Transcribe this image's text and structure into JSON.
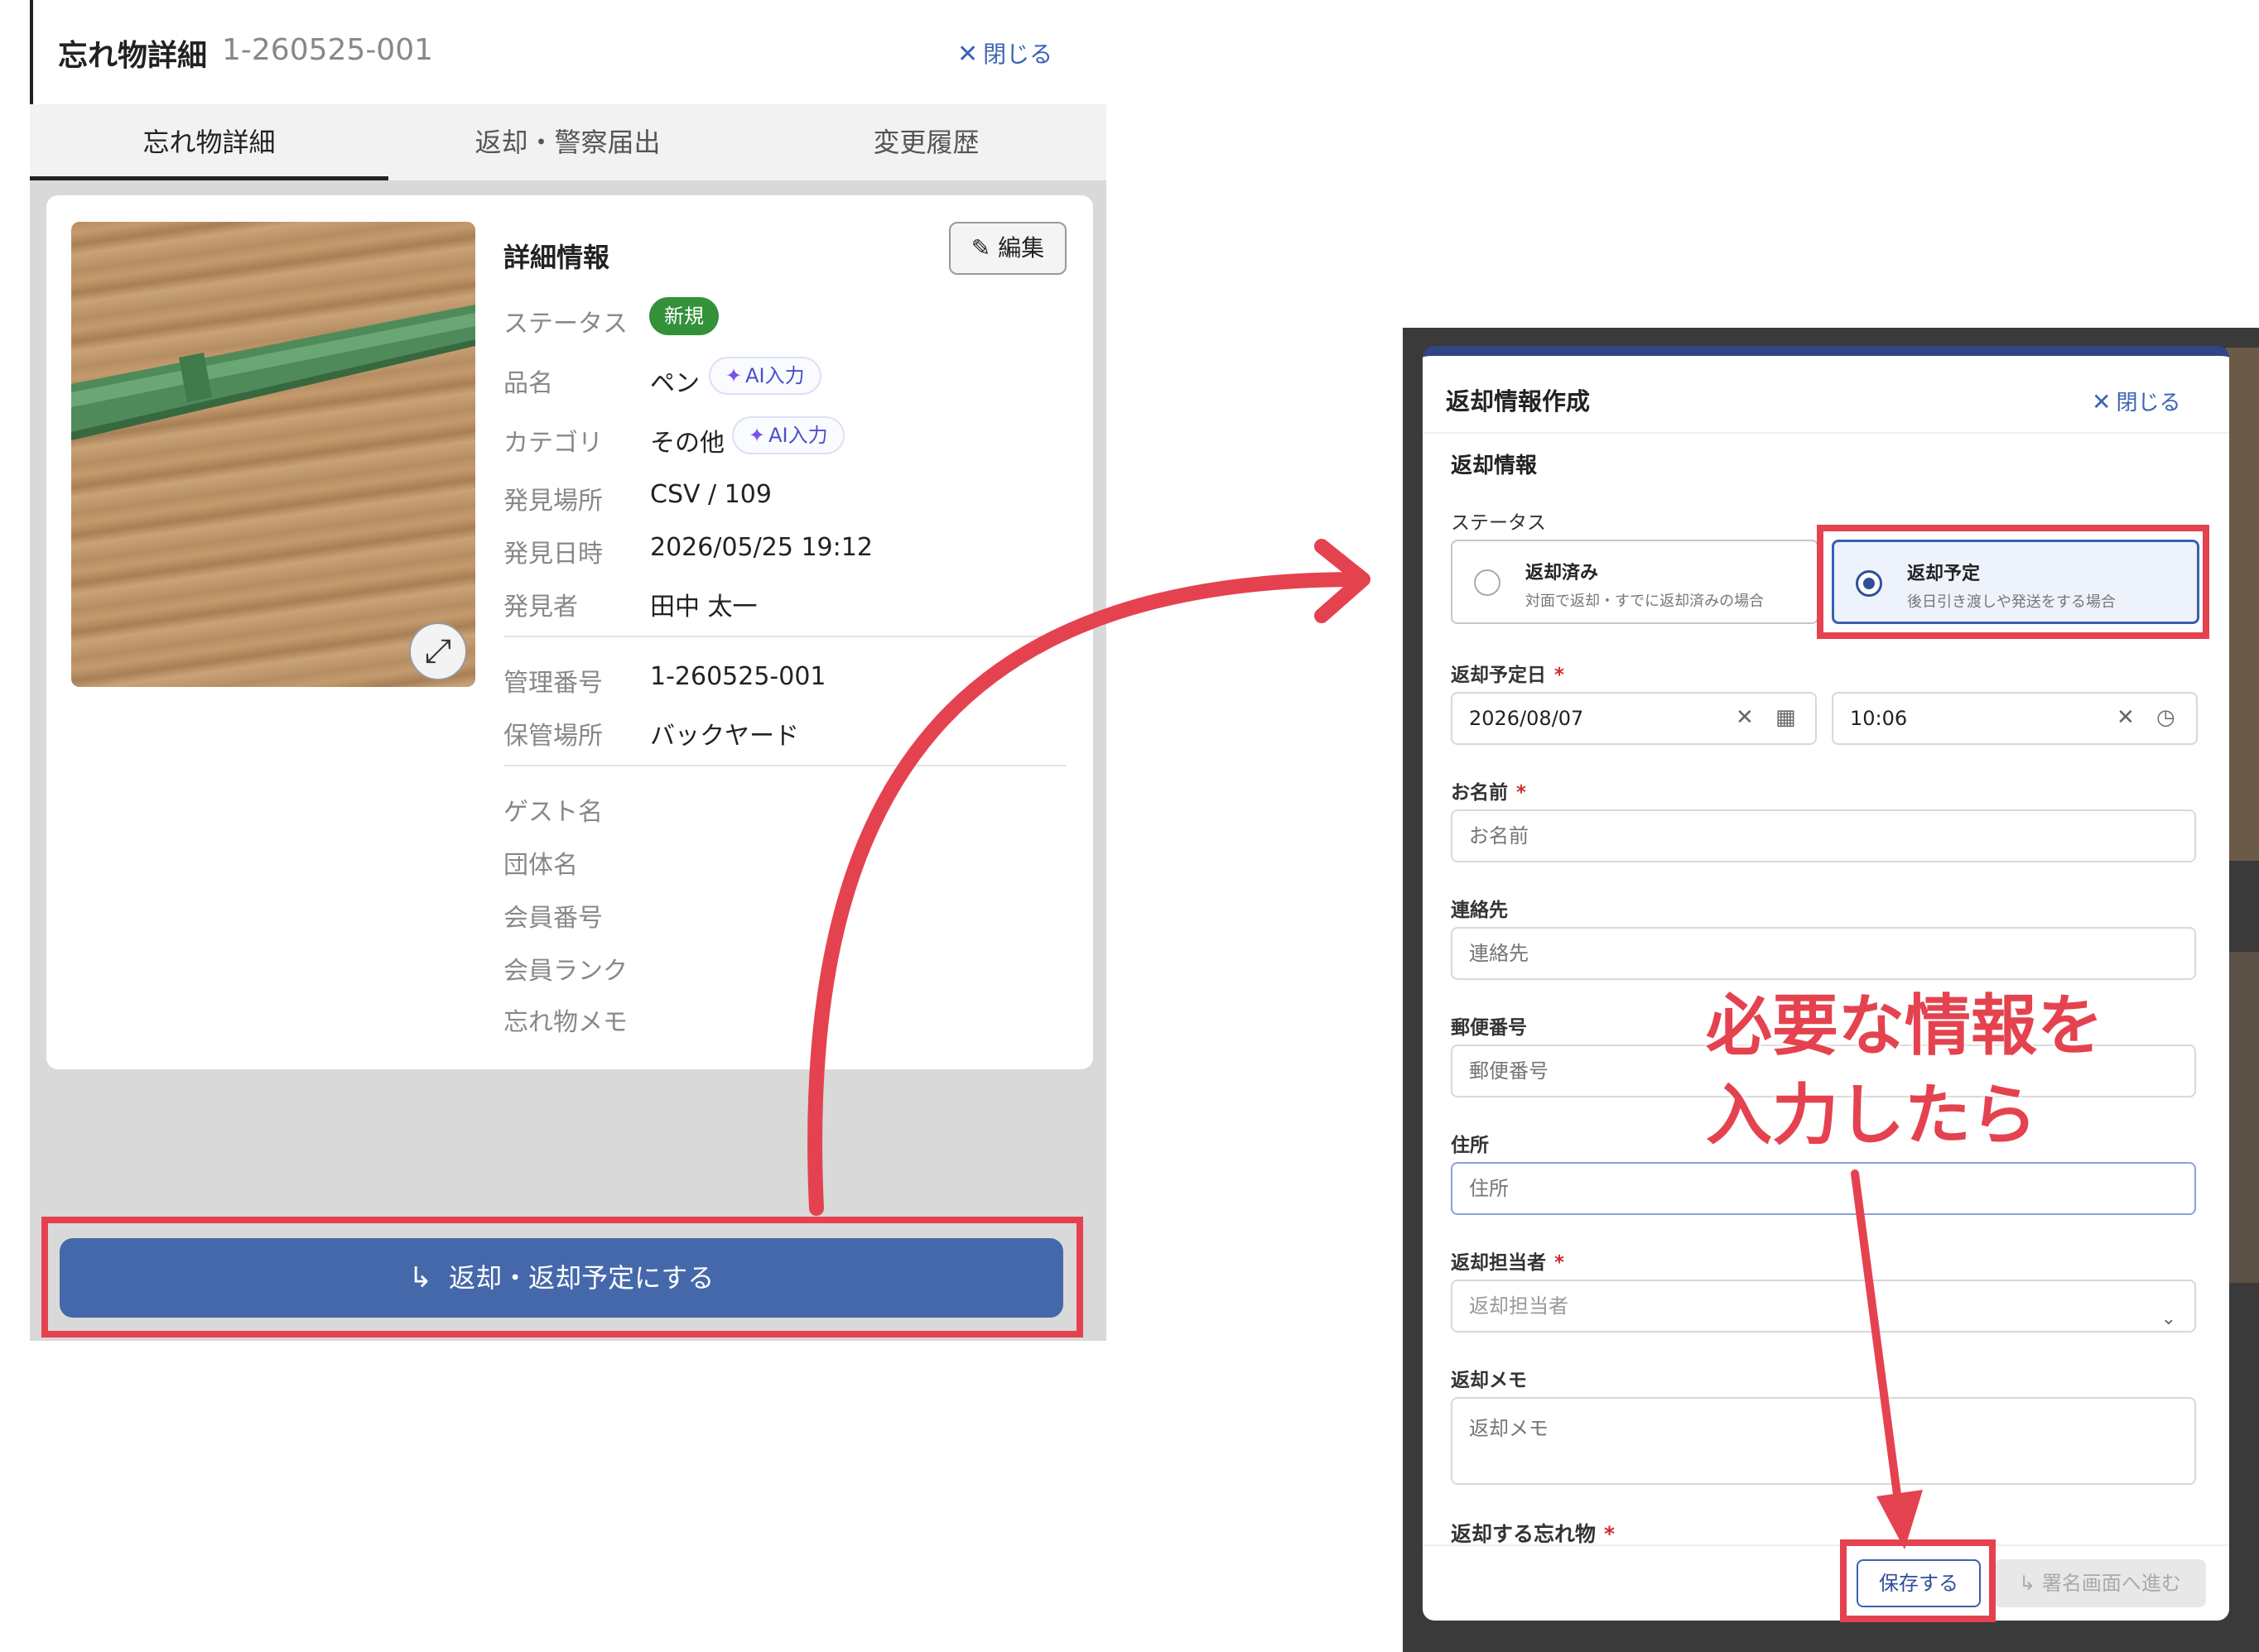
{
  "left": {
    "title": "忘れ物詳細",
    "item_id": "1-260525-001",
    "close_label": "閉じる",
    "tabs": [
      "忘れ物詳細",
      "返却・警察届出",
      "変更履歴"
    ],
    "detail_title": "詳細情報",
    "edit_label": "編集",
    "ai_label": "AI入力",
    "status_label": "ステータス",
    "status_value": "新規",
    "fields": {
      "name": {
        "label": "品名",
        "value": "ペン"
      },
      "category": {
        "label": "カテゴリ",
        "value": "その他"
      },
      "found_place": {
        "label": "発見場所",
        "value": "CSV / 109"
      },
      "found_at": {
        "label": "発見日時",
        "value": "2026/05/25 19:12"
      },
      "finder": {
        "label": "発見者",
        "value": "田中 太一"
      },
      "mgmt_no": {
        "label": "管理番号",
        "value": "1-260525-001"
      },
      "storage": {
        "label": "保管場所",
        "value": "バックヤード"
      },
      "guest": {
        "label": "ゲスト名"
      },
      "group": {
        "label": "団体名"
      },
      "member_no": {
        "label": "会員番号"
      },
      "member_rank": {
        "label": "会員ランク"
      },
      "memo": {
        "label": "忘れ物メモ"
      }
    },
    "main_action_label": "返却・返却予定にする"
  },
  "modal": {
    "title": "返却情報作成",
    "close_label": "閉じる",
    "section_title": "返却情報",
    "status_label": "ステータス",
    "options": [
      {
        "title": "返却済み",
        "desc": "対面で返却・すでに返却済みの場合",
        "selected": false
      },
      {
        "title": "返却予定",
        "desc": "後日引き渡しや発送をする場合",
        "selected": true
      }
    ],
    "return_date_label": "返却予定日",
    "return_date": "2026/08/07",
    "return_time": "10:06",
    "name_label": "お名前",
    "name_placeholder": "お名前",
    "contact_label": "連絡先",
    "contact_placeholder": "連絡先",
    "zip_label": "郵便番号",
    "zip_placeholder": "郵便番号",
    "address_label": "住所",
    "address_placeholder": "住所",
    "staff_label": "返却担当者",
    "staff_placeholder": "返却担当者",
    "memo_label": "返却メモ",
    "memo_placeholder": "返却メモ",
    "items_label": "返却する忘れ物",
    "save_label": "保存する",
    "sign_label": "署名画面へ進む"
  },
  "annotation": {
    "line1": "必要な情報を",
    "line2": "入力したら",
    "color": "#e5424f"
  },
  "colors": {
    "primary": "#4568ab",
    "status_new": "#33913a",
    "modal_accent": "#2f4586"
  }
}
